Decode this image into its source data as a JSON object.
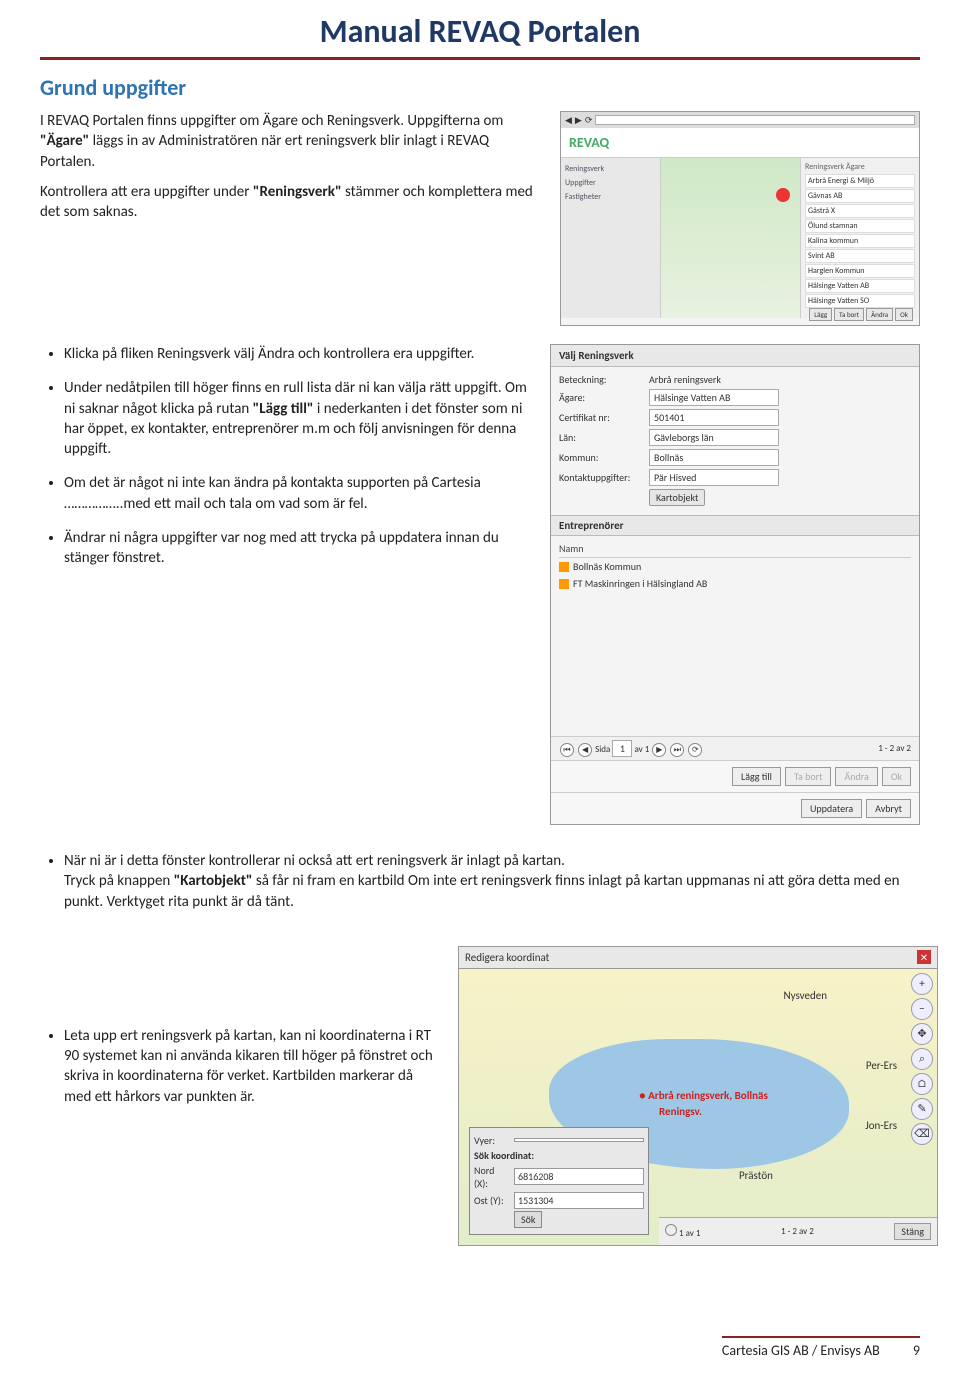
{
  "doc_title": "Manual REVAQ Portalen",
  "section": "Grund uppgifter",
  "intro_1a": "I REVAQ Portalen finns uppgifter om Ägare och Reningsverk. Uppgifterna om ",
  "intro_1b": "\"Ägare\"",
  "intro_1c": " läggs in av Administratören när ert reningsverk blir inlagt i REVAQ Portalen.",
  "intro_2a": " Kontrollera att era uppgifter under ",
  "intro_2b": "\"Reningsverk\"",
  "intro_2c": " stämmer och komplettera med det som saknas.",
  "b1": "Klicka på fliken Reningsverk välj Ändra och kontrollera era uppgifter.",
  "b2a": "Under nedåtpilen till höger finns en rull lista där ni kan välja rätt uppgift. Om ni saknar något klicka på rutan ",
  "b2b": "\"Lägg till\"",
  "b2c": " i nederkanten i det fönster som ni har öppet, ex kontakter, entreprenörer m.m och följ anvisningen för denna uppgift.",
  "b3": "Om det är något ni inte kan ändra på kontakta supporten på Cartesia ……………..med ett mail och tala om vad som är fel.",
  "b4": "Ändrar ni några uppgifter var nog med att trycka på uppdatera innan du stänger fönstret.",
  "b5a": "När ni är i detta fönster kontrollerar ni också att ert reningsverk är inlagt på kartan.",
  "b5b_1": "Tryck på knappen ",
  "b5b_2": "\"Kartobjekt\"",
  "b5b_3": " så får ni fram en kartbild Om inte ert reningsverk finns inlagt på kartan uppmanas ni att göra detta med en punkt. Verktyget rita punkt är då tänt.",
  "b6": "Leta upp ert reningsverk på kartan, kan ni koordinaterna i RT 90 systemet kan ni använda kikaren till höger på fönstret och skriva in koordinaterna för verket. Kartbilden markerar då med ett hårkors var punkten är.",
  "shot_top": {
    "logo": "REVAQ",
    "side": [
      "Reningsverk",
      "",
      "Uppgifter",
      "",
      "Fastigheter"
    ],
    "panel_hdr": "Reningsverk Ägare",
    "rows": [
      "Arbrå Energi & Miljö",
      "Gävnas AB",
      "Gästrå X",
      "Ölund stamnan",
      "Kalina kommun",
      "Svint AB",
      "Harglen Kommun",
      "Hälsinge Vatten AB",
      "Hälsinge Vatten SO"
    ],
    "btns": [
      "Lägg",
      "Ta bort",
      "Ändra",
      "Ok"
    ]
  },
  "shot_mid": {
    "title": "Välj Reningsverk",
    "rows": {
      "Beteckning": "Arbrå reningsverk",
      "Ägare": "Hälsinge Vatten AB",
      "Certifikat": "501401",
      "Lan": "Gävleborgs län",
      "Kommun": "Bollnäs",
      "Kontakt": "Pär Hisved"
    },
    "labels": {
      "bet": "Beteckning:",
      "ag": "Ägare:",
      "cert": "Certifikat nr:",
      "lan": "Län:",
      "kom": "Kommun:",
      "kon": "Kontaktuppgifter:"
    },
    "kartobjekt": "Kartobjekt",
    "sub": "Entreprenörer",
    "thead": "Namn",
    "trows": [
      "Bollnäs Kommun",
      "FT Maskinringen i Hälsingland AB"
    ],
    "page_label": "Sida",
    "page_val": "1",
    "page_of": "av 1",
    "page_count": "1 - 2 av 2",
    "bar1": [
      "Lägg till",
      "Ta bort",
      "Ändra",
      "Ok"
    ],
    "bar2": [
      "Uppdatera",
      "Avbryt"
    ]
  },
  "shot_map": {
    "hdr": "Redigera koordinat",
    "labels": {
      "ny": "Nysveden",
      "pe": "Per-Ers",
      "je": "Jon-Ers",
      "re": "Reningsv.",
      "ar": "Arbrå reningsverk, Bollnäs",
      "pr": "Prästön"
    },
    "panel": {
      "vyer": "Vyer:",
      "sok_hdr": "Sök koordinat:",
      "nord": "Nord (X):",
      "ost": "Ost (Y):",
      "nval": "6816208",
      "oval": "1531304",
      "sok": "Sök"
    },
    "tools": [
      "+",
      "−",
      "✥",
      "⌕",
      "⌂",
      "✎",
      "⌫"
    ],
    "footer": {
      "av": "1 av 1",
      "count": "1 - 2 av 2",
      "stang": "Stäng"
    }
  },
  "footer": {
    "left": "Cartesia GIS AB  / Envisys AB",
    "page": "9"
  }
}
